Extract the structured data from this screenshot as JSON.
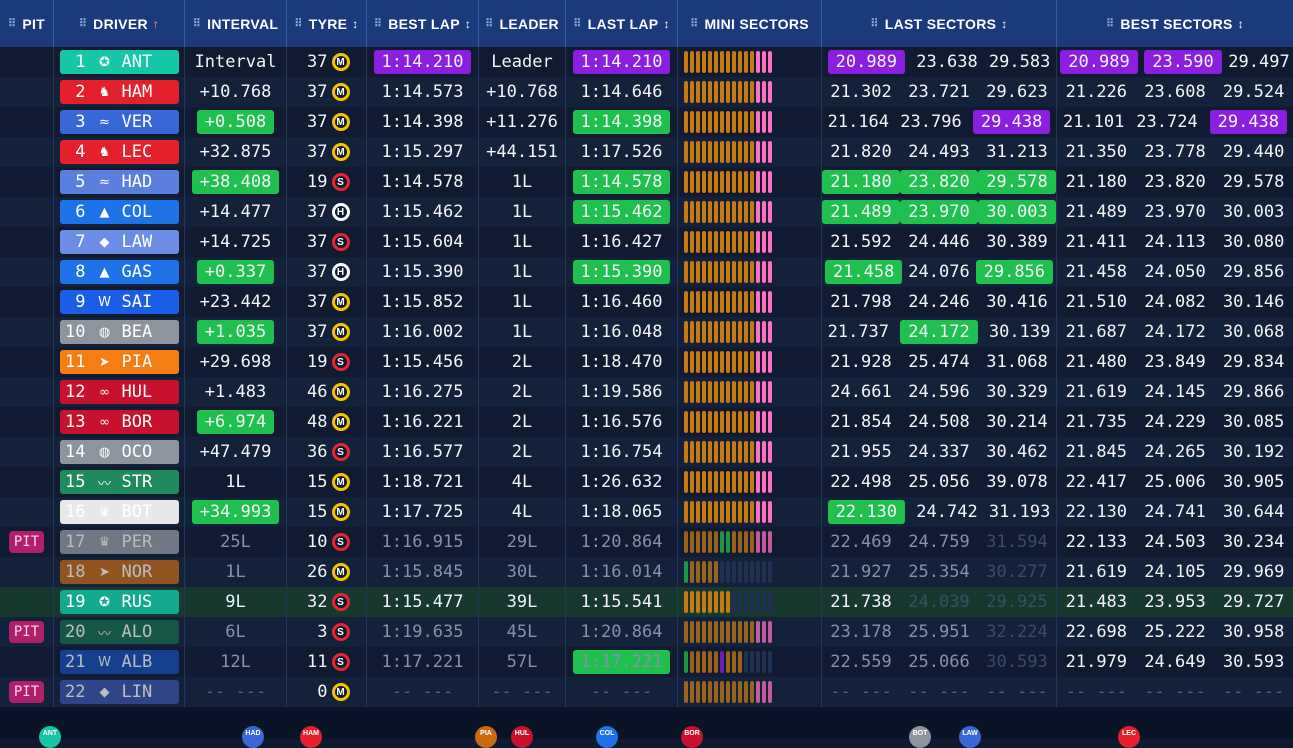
{
  "header": {
    "pit": "PIT",
    "driver": "DRIVER",
    "interval": "INTERVAL",
    "tyre": "TYRE",
    "best_lap": "BEST LAP",
    "leader": "LEADER",
    "last_lap": "LAST LAP",
    "mini_sectors": "MINI SECTORS",
    "last_sectors": "LAST SECTORS",
    "best_sectors": "BEST SECTORS"
  },
  "colors": {
    "green": "#1fc04d",
    "purple": "#8b1fe0",
    "header": "#1a3a7c"
  },
  "rows": [
    {
      "pit": "",
      "pos": "1",
      "code": "ANT",
      "team_color": "#15c7a5",
      "team_icon": "mercedes-star-icon",
      "interval": "Interval",
      "int_hl": "",
      "tyre_age": "37",
      "tyre": "M",
      "best": "1:14.210",
      "best_hl": "p",
      "leader": "Leader",
      "last": "1:14.210",
      "last_hl": "p",
      "mini": "ooooooooooooppp",
      "ls": [
        "20.989",
        "23.638",
        "29.583"
      ],
      "ls_hl": [
        "p",
        "",
        ""
      ],
      "bs": [
        "20.989",
        "23.590",
        "29.497"
      ],
      "bs_hl": [
        "p",
        "p",
        ""
      ],
      "state": ""
    },
    {
      "pit": "",
      "pos": "2",
      "code": "HAM",
      "team_color": "#e3202b",
      "team_icon": "ferrari-horse-icon",
      "interval": "+10.768",
      "int_hl": "",
      "tyre_age": "37",
      "tyre": "M",
      "best": "1:14.573",
      "best_hl": "",
      "leader": "+10.768",
      "last": "1:14.646",
      "last_hl": "",
      "mini": "ooooooooooooppp",
      "ls": [
        "21.302",
        "23.721",
        "29.623"
      ],
      "ls_hl": [
        "",
        "",
        ""
      ],
      "bs": [
        "21.226",
        "23.608",
        "29.524"
      ],
      "bs_hl": [
        "",
        "",
        ""
      ],
      "state": ""
    },
    {
      "pit": "",
      "pos": "3",
      "code": "VER",
      "team_color": "#3a67d6",
      "team_icon": "red-bull-icon",
      "interval": "+0.508",
      "int_hl": "g",
      "tyre_age": "37",
      "tyre": "M",
      "best": "1:14.398",
      "best_hl": "",
      "leader": "+11.276",
      "last": "1:14.398",
      "last_hl": "g",
      "mini": "ooooooooooooppp",
      "ls": [
        "21.164",
        "23.796",
        "29.438"
      ],
      "ls_hl": [
        "",
        "",
        "p"
      ],
      "bs": [
        "21.101",
        "23.724",
        "29.438"
      ],
      "bs_hl": [
        "",
        "",
        "p"
      ],
      "state": ""
    },
    {
      "pit": "",
      "pos": "4",
      "code": "LEC",
      "team_color": "#e3202b",
      "team_icon": "ferrari-horse-icon",
      "interval": "+32.875",
      "int_hl": "",
      "tyre_age": "37",
      "tyre": "M",
      "best": "1:15.297",
      "best_hl": "",
      "leader": "+44.151",
      "last": "1:17.526",
      "last_hl": "",
      "mini": "ooooooooooooppp",
      "ls": [
        "21.820",
        "24.493",
        "31.213"
      ],
      "ls_hl": [
        "",
        "",
        ""
      ],
      "bs": [
        "21.350",
        "23.778",
        "29.440"
      ],
      "bs_hl": [
        "",
        "",
        ""
      ],
      "state": ""
    },
    {
      "pit": "",
      "pos": "5",
      "code": "HAD",
      "team_color": "#5b7fdc",
      "team_icon": "racing-bulls-icon",
      "interval": "+38.408",
      "int_hl": "g",
      "tyre_age": "19",
      "tyre": "S",
      "best": "1:14.578",
      "best_hl": "",
      "leader": "1L",
      "last": "1:14.578",
      "last_hl": "g",
      "mini": "ooooooooooooppp",
      "ls": [
        "21.180",
        "23.820",
        "29.578"
      ],
      "ls_hl": [
        "g",
        "g",
        "g"
      ],
      "bs": [
        "21.180",
        "23.820",
        "29.578"
      ],
      "bs_hl": [
        "",
        "",
        ""
      ],
      "state": ""
    },
    {
      "pit": "",
      "pos": "6",
      "code": "COL",
      "team_color": "#1e73e8",
      "team_icon": "alpine-icon",
      "interval": "+14.477",
      "int_hl": "",
      "tyre_age": "37",
      "tyre": "H",
      "best": "1:15.462",
      "best_hl": "",
      "leader": "1L",
      "last": "1:15.462",
      "last_hl": "g",
      "mini": "ooooooooooooppp",
      "ls": [
        "21.489",
        "23.970",
        "30.003"
      ],
      "ls_hl": [
        "g",
        "g",
        "g"
      ],
      "bs": [
        "21.489",
        "23.970",
        "30.003"
      ],
      "bs_hl": [
        "",
        "",
        ""
      ],
      "state": ""
    },
    {
      "pit": "",
      "pos": "7",
      "code": "LAW",
      "team_color": "#6b8de6",
      "team_icon": "visa-rb-icon",
      "interval": "+14.725",
      "int_hl": "",
      "tyre_age": "37",
      "tyre": "S",
      "best": "1:15.604",
      "best_hl": "",
      "leader": "1L",
      "last": "1:16.427",
      "last_hl": "",
      "mini": "ooooooooooooppp",
      "ls": [
        "21.592",
        "24.446",
        "30.389"
      ],
      "ls_hl": [
        "",
        "",
        ""
      ],
      "bs": [
        "21.411",
        "24.113",
        "30.080"
      ],
      "bs_hl": [
        "",
        "",
        ""
      ],
      "state": ""
    },
    {
      "pit": "",
      "pos": "8",
      "code": "GAS",
      "team_color": "#1e73e8",
      "team_icon": "alpine-icon",
      "interval": "+0.337",
      "int_hl": "g",
      "tyre_age": "37",
      "tyre": "H",
      "best": "1:15.390",
      "best_hl": "",
      "leader": "1L",
      "last": "1:15.390",
      "last_hl": "g",
      "mini": "ooooooooooooppp",
      "ls": [
        "21.458",
        "24.076",
        "29.856"
      ],
      "ls_hl": [
        "g",
        "",
        "g"
      ],
      "bs": [
        "21.458",
        "24.050",
        "29.856"
      ],
      "bs_hl": [
        "",
        "",
        ""
      ],
      "state": ""
    },
    {
      "pit": "",
      "pos": "9",
      "code": "SAI",
      "team_color": "#1a5ee8",
      "team_icon": "williams-icon",
      "interval": "+23.442",
      "int_hl": "",
      "tyre_age": "37",
      "tyre": "M",
      "best": "1:15.852",
      "best_hl": "",
      "leader": "1L",
      "last": "1:16.460",
      "last_hl": "",
      "mini": "ooooooooooooppp",
      "ls": [
        "21.798",
        "24.246",
        "30.416"
      ],
      "ls_hl": [
        "",
        "",
        ""
      ],
      "bs": [
        "21.510",
        "24.082",
        "30.146"
      ],
      "bs_hl": [
        "",
        "",
        ""
      ],
      "state": ""
    },
    {
      "pit": "",
      "pos": "10",
      "code": "BEA",
      "team_color": "#8e949e",
      "team_icon": "haas-icon",
      "interval": "+1.035",
      "int_hl": "g",
      "tyre_age": "37",
      "tyre": "M",
      "best": "1:16.002",
      "best_hl": "",
      "leader": "1L",
      "last": "1:16.048",
      "last_hl": "",
      "mini": "ooooooooooooppp",
      "ls": [
        "21.737",
        "24.172",
        "30.139"
      ],
      "ls_hl": [
        "",
        "g",
        ""
      ],
      "bs": [
        "21.687",
        "24.172",
        "30.068"
      ],
      "bs_hl": [
        "",
        "",
        ""
      ],
      "state": ""
    },
    {
      "pit": "",
      "pos": "11",
      "code": "PIA",
      "team_color": "#f57d12",
      "team_icon": "mclaren-swoosh-icon",
      "interval": "+29.698",
      "int_hl": "",
      "tyre_age": "19",
      "tyre": "S",
      "best": "1:15.456",
      "best_hl": "",
      "leader": "2L",
      "last": "1:18.470",
      "last_hl": "",
      "mini": "ooooooooooooppp",
      "ls": [
        "21.928",
        "25.474",
        "31.068"
      ],
      "ls_hl": [
        "",
        "",
        ""
      ],
      "bs": [
        "21.480",
        "23.849",
        "29.834"
      ],
      "bs_hl": [
        "",
        "",
        ""
      ],
      "state": ""
    },
    {
      "pit": "",
      "pos": "12",
      "code": "HUL",
      "team_color": "#c8112e",
      "team_icon": "audi-rings-icon",
      "interval": "+1.483",
      "int_hl": "",
      "tyre_age": "46",
      "tyre": "M",
      "best": "1:16.275",
      "best_hl": "",
      "leader": "2L",
      "last": "1:19.586",
      "last_hl": "",
      "mini": "ooooooooooooppp",
      "ls": [
        "24.661",
        "24.596",
        "30.329"
      ],
      "ls_hl": [
        "",
        "",
        ""
      ],
      "bs": [
        "21.619",
        "24.145",
        "29.866"
      ],
      "bs_hl": [
        "",
        "",
        ""
      ],
      "state": ""
    },
    {
      "pit": "",
      "pos": "13",
      "code": "BOR",
      "team_color": "#c8112e",
      "team_icon": "audi-rings-icon",
      "interval": "+6.974",
      "int_hl": "g",
      "tyre_age": "48",
      "tyre": "M",
      "best": "1:16.221",
      "best_hl": "",
      "leader": "2L",
      "last": "1:16.576",
      "last_hl": "",
      "mini": "ooooooooooooppp",
      "ls": [
        "21.854",
        "24.508",
        "30.214"
      ],
      "ls_hl": [
        "",
        "",
        ""
      ],
      "bs": [
        "21.735",
        "24.229",
        "30.085"
      ],
      "bs_hl": [
        "",
        "",
        ""
      ],
      "state": ""
    },
    {
      "pit": "",
      "pos": "14",
      "code": "OCO",
      "team_color": "#8e949e",
      "team_icon": "haas-icon",
      "interval": "+47.479",
      "int_hl": "",
      "tyre_age": "36",
      "tyre": "S",
      "best": "1:16.577",
      "best_hl": "",
      "leader": "2L",
      "last": "1:16.754",
      "last_hl": "",
      "mini": "ooooooooooooppp",
      "ls": [
        "21.955",
        "24.337",
        "30.462"
      ],
      "ls_hl": [
        "",
        "",
        ""
      ],
      "bs": [
        "21.845",
        "24.265",
        "30.192"
      ],
      "bs_hl": [
        "",
        "",
        ""
      ],
      "state": ""
    },
    {
      "pit": "",
      "pos": "15",
      "code": "STR",
      "team_color": "#1f8a5e",
      "team_icon": "aston-wings-icon",
      "interval": "1L",
      "int_hl": "",
      "tyre_age": "15",
      "tyre": "M",
      "best": "1:18.721",
      "best_hl": "",
      "leader": "4L",
      "last": "1:26.632",
      "last_hl": "",
      "mini": "ooooooooooooppp",
      "ls": [
        "22.498",
        "25.056",
        "39.078"
      ],
      "ls_hl": [
        "",
        "",
        ""
      ],
      "bs": [
        "22.417",
        "25.006",
        "30.905"
      ],
      "bs_hl": [
        "",
        "",
        ""
      ],
      "state": ""
    },
    {
      "pit": "",
      "pos": "16",
      "code": "BOT",
      "team_color": "#e8e8e8",
      "team_icon": "cadillac-crest-icon",
      "interval": "+34.993",
      "int_hl": "g",
      "tyre_age": "15",
      "tyre": "M",
      "best": "1:17.725",
      "best_hl": "",
      "leader": "4L",
      "last": "1:18.065",
      "last_hl": "",
      "mini": "ooooooooooooppp",
      "ls": [
        "22.130",
        "24.742",
        "31.193"
      ],
      "ls_hl": [
        "g",
        "",
        ""
      ],
      "bs": [
        "22.130",
        "24.741",
        "30.644"
      ],
      "bs_hl": [
        "",
        "",
        ""
      ],
      "state": ""
    },
    {
      "pit": "PIT",
      "pos": "17",
      "code": "PER",
      "team_color": "#9aa0a8",
      "team_icon": "cadillac-crest-icon",
      "interval": "25L",
      "int_hl": "",
      "tyre_age": "10",
      "tyre": "S",
      "best": "1:16.915",
      "best_hl": "",
      "leader": "29L",
      "last": "1:20.864",
      "last_hl": "",
      "mini": "ooooooGGooooppp",
      "ls": [
        "22.469",
        "24.759",
        "31.594"
      ],
      "ls_hl": [
        "",
        "",
        ""
      ],
      "bs": [
        "22.133",
        "24.503",
        "30.234"
      ],
      "bs_hl": [
        "",
        "",
        ""
      ],
      "state": "dim"
    },
    {
      "pit": "",
      "pos": "18",
      "code": "NOR",
      "team_color": "#c86a14",
      "team_icon": "mclaren-swoosh-icon",
      "interval": "1L",
      "int_hl": "",
      "tyre_age": "26",
      "tyre": "M",
      "best": "1:15.845",
      "best_hl": "",
      "leader": "30L",
      "last": "1:16.014",
      "last_hl": "",
      "mini": "Goooooxxxxxxxxx",
      "ls": [
        "21.927",
        "25.354",
        "30.277"
      ],
      "ls_hl": [
        "",
        "",
        ""
      ],
      "bs": [
        "21.619",
        "24.105",
        "29.969"
      ],
      "bs_hl": [
        "",
        "",
        ""
      ],
      "state": "dim"
    },
    {
      "pit": "",
      "pos": "19",
      "code": "RUS",
      "team_color": "#12a98c",
      "team_icon": "mercedes-star-icon",
      "interval": "9L",
      "int_hl": "",
      "tyre_age": "32",
      "tyre": "S",
      "best": "1:15.477",
      "best_hl": "",
      "leader": "39L",
      "last": "1:15.541",
      "last_hl": "",
      "mini": "ooooooooxxxxxxx",
      "ls": [
        "21.738",
        "24.039",
        "29.925"
      ],
      "ls_hl": [
        "",
        "",
        ""
      ],
      "bs": [
        "21.483",
        "23.953",
        "29.727"
      ],
      "bs_hl": [
        "",
        "",
        ""
      ],
      "state": "hl"
    },
    {
      "pit": "PIT",
      "pos": "20",
      "code": "ALO",
      "team_color": "#1a6e4c",
      "team_icon": "aston-wings-icon",
      "interval": "6L",
      "int_hl": "",
      "tyre_age": "3",
      "tyre": "S",
      "best": "1:19.635",
      "best_hl": "",
      "leader": "45L",
      "last": "1:20.864",
      "last_hl": "",
      "mini": "ooooooooooooppp",
      "ls": [
        "23.178",
        "25.951",
        "32.224"
      ],
      "ls_hl": [
        "",
        "",
        ""
      ],
      "bs": [
        "22.698",
        "25.222",
        "30.958"
      ],
      "bs_hl": [
        "",
        "",
        ""
      ],
      "state": "dim"
    },
    {
      "pit": "",
      "pos": "21",
      "code": "ALB",
      "team_color": "#1a4fb8",
      "team_icon": "williams-icon",
      "interval": "12L",
      "int_hl": "",
      "tyre_age": "11",
      "tyre": "S",
      "best": "1:17.221",
      "best_hl": "",
      "leader": "57L",
      "last": "1:17.221",
      "last_hl": "g",
      "mini": "GoooooPoooxxxxx",
      "ls": [
        "22.559",
        "25.066",
        "30.593"
      ],
      "ls_hl": [
        "",
        "",
        ""
      ],
      "bs": [
        "21.979",
        "24.649",
        "30.593"
      ],
      "bs_hl": [
        "",
        "",
        ""
      ],
      "state": "dim"
    },
    {
      "pit": "PIT",
      "pos": "22",
      "code": "LIN",
      "team_color": "#3a56a8",
      "team_icon": "visa-rb-icon",
      "interval": "-- ---",
      "int_hl": "",
      "tyre_age": "0",
      "tyre": "M",
      "best": "-- ---",
      "best_hl": "",
      "leader": "-- ---",
      "last": "-- ---",
      "last_hl": "",
      "mini": "ooooooooooooppp",
      "ls": [
        "-- ---",
        "-- ---",
        "-- ---"
      ],
      "ls_hl": [
        "",
        "",
        ""
      ],
      "bs": [
        "-- ---",
        "-- ---",
        "-- ---"
      ],
      "bs_hl": [
        "",
        "",
        ""
      ],
      "state": "none"
    }
  ],
  "track_markers": [
    {
      "label": "ANT",
      "color": "#15c7a5",
      "pos": 0.03
    },
    {
      "label": "HAD",
      "color": "#3a67d6",
      "pos": 0.187
    },
    {
      "label": "HAM",
      "color": "#e3202b",
      "pos": 0.232
    },
    {
      "label": "PIA",
      "color": "#c86a14",
      "pos": 0.367
    },
    {
      "label": "HUL",
      "color": "#c8112e",
      "pos": 0.395
    },
    {
      "label": "COL",
      "color": "#1e73e8",
      "pos": 0.461
    },
    {
      "label": "BOR",
      "color": "#c8112e",
      "pos": 0.527
    },
    {
      "label": "BOT",
      "color": "#8e949e",
      "pos": 0.703
    },
    {
      "label": "LAW",
      "color": "#3a67d6",
      "pos": 0.742
    },
    {
      "label": "LEC",
      "color": "#e3202b",
      "pos": 0.865
    }
  ]
}
